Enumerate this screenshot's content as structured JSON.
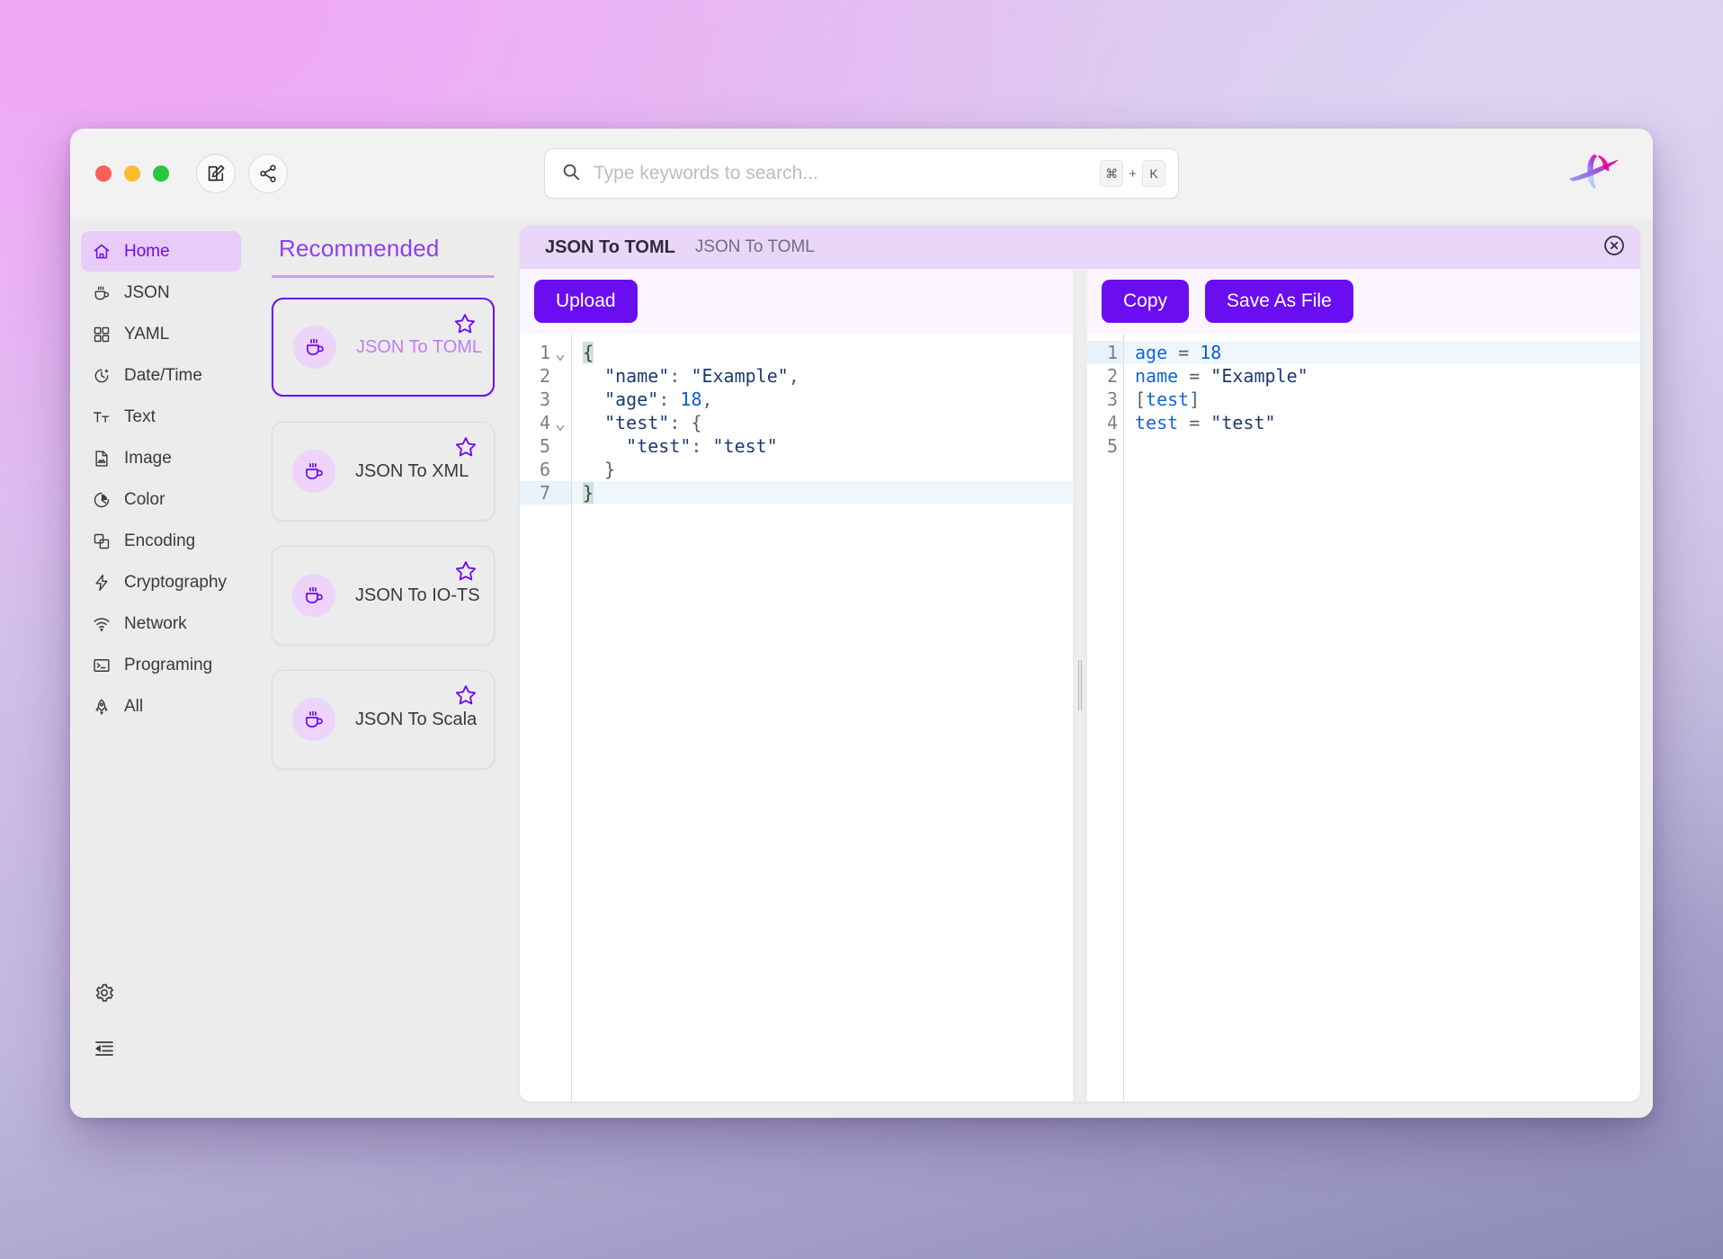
{
  "window": {
    "traffic_lights": [
      "close",
      "minimize",
      "maximize"
    ],
    "actions": [
      {
        "name": "compose",
        "label": "New"
      },
      {
        "name": "share",
        "label": "Share"
      }
    ]
  },
  "search": {
    "placeholder": "Type keywords to search...",
    "value": "",
    "shortcut_modifier": "⌘",
    "shortcut_plus": "+",
    "shortcut_key": "K"
  },
  "sidebar": {
    "items": [
      {
        "label": "Home",
        "icon": "home-icon",
        "active": true
      },
      {
        "label": "JSON",
        "icon": "cup-icon",
        "active": false
      },
      {
        "label": "YAML",
        "icon": "grid-icon",
        "active": false
      },
      {
        "label": "Date/Time",
        "icon": "clock-icon",
        "active": false
      },
      {
        "label": "Text",
        "icon": "text-icon",
        "active": false
      },
      {
        "label": "Image",
        "icon": "image-icon",
        "active": false
      },
      {
        "label": "Color",
        "icon": "pie-icon",
        "active": false
      },
      {
        "label": "Encoding",
        "icon": "layers-icon",
        "active": false
      },
      {
        "label": "Cryptography",
        "icon": "lightning-icon",
        "active": false
      },
      {
        "label": "Network",
        "icon": "wifi-icon",
        "active": false
      },
      {
        "label": "Programing",
        "icon": "terminal-icon",
        "active": false
      },
      {
        "label": "All",
        "icon": "rocket-icon",
        "active": false
      }
    ],
    "bottom": [
      {
        "name": "settings",
        "icon": "gear-icon"
      },
      {
        "name": "collapse-sidebar",
        "icon": "collapse-icon"
      }
    ]
  },
  "recommended": {
    "title": "Recommended",
    "cards": [
      {
        "label": "JSON To TOML",
        "icon": "cup-icon",
        "starred": false,
        "selected": true
      },
      {
        "label": "JSON To XML",
        "icon": "cup-icon",
        "starred": false,
        "selected": false
      },
      {
        "label": "JSON To IO-TS",
        "icon": "cup-icon",
        "starred": false,
        "selected": false
      },
      {
        "label": "JSON To Scala",
        "icon": "cup-icon",
        "starred": false,
        "selected": false
      }
    ]
  },
  "tool": {
    "tab_title": "JSON To TOML",
    "tab_subtitle": "JSON To TOML",
    "close_label": "Close"
  },
  "input_editor": {
    "upload_label": "Upload",
    "active_line": 7,
    "lines": [
      {
        "n": 1,
        "fold": true,
        "tokens": [
          {
            "t": "{",
            "c": "match"
          }
        ]
      },
      {
        "n": 2,
        "fold": false,
        "tokens": [
          {
            "t": "  ",
            "c": "punct"
          },
          {
            "t": "\"name\"",
            "c": "str"
          },
          {
            "t": ": ",
            "c": "punct"
          },
          {
            "t": "\"Example\"",
            "c": "str"
          },
          {
            "t": ",",
            "c": "punct"
          }
        ]
      },
      {
        "n": 3,
        "fold": false,
        "tokens": [
          {
            "t": "  ",
            "c": "punct"
          },
          {
            "t": "\"age\"",
            "c": "str"
          },
          {
            "t": ": ",
            "c": "punct"
          },
          {
            "t": "18",
            "c": "num"
          },
          {
            "t": ",",
            "c": "punct"
          }
        ]
      },
      {
        "n": 4,
        "fold": true,
        "tokens": [
          {
            "t": "  ",
            "c": "punct"
          },
          {
            "t": "\"test\"",
            "c": "str"
          },
          {
            "t": ": ",
            "c": "punct"
          },
          {
            "t": "{",
            "c": "punct"
          }
        ]
      },
      {
        "n": 5,
        "fold": false,
        "tokens": [
          {
            "t": "    ",
            "c": "punct"
          },
          {
            "t": "\"test\"",
            "c": "str"
          },
          {
            "t": ": ",
            "c": "punct"
          },
          {
            "t": "\"test\"",
            "c": "str"
          }
        ]
      },
      {
        "n": 6,
        "fold": false,
        "tokens": [
          {
            "t": "  ",
            "c": "punct"
          },
          {
            "t": "}",
            "c": "punct"
          }
        ]
      },
      {
        "n": 7,
        "fold": false,
        "tokens": [
          {
            "t": "}",
            "c": "match"
          }
        ]
      }
    ],
    "raw_text": "{\n  \"name\": \"Example\",\n  \"age\": 18,\n  \"test\": {\n    \"test\": \"test\"\n  }\n}"
  },
  "output_editor": {
    "copy_label": "Copy",
    "save_label": "Save As File",
    "active_line": 1,
    "lines": [
      {
        "n": 1,
        "tokens": [
          {
            "t": "age",
            "c": "key"
          },
          {
            "t": " = ",
            "c": "punct"
          },
          {
            "t": "18",
            "c": "num"
          }
        ]
      },
      {
        "n": 2,
        "tokens": [
          {
            "t": "name",
            "c": "key"
          },
          {
            "t": " = ",
            "c": "punct"
          },
          {
            "t": "\"Example\"",
            "c": "str"
          }
        ]
      },
      {
        "n": 3,
        "tokens": [
          {
            "t": "[",
            "c": "punct"
          },
          {
            "t": "test",
            "c": "key"
          },
          {
            "t": "]",
            "c": "punct"
          }
        ]
      },
      {
        "n": 4,
        "tokens": [
          {
            "t": "test",
            "c": "key"
          },
          {
            "t": " = ",
            "c": "punct"
          },
          {
            "t": "\"test\"",
            "c": "str"
          }
        ]
      },
      {
        "n": 5,
        "tokens": []
      }
    ],
    "raw_text": "age = 18\nname = \"Example\"\n[test]\ntest = \"test\"\n"
  },
  "colors": {
    "accent": "#6a0df0",
    "accent_light": "#8e3ff0",
    "tab_bar": "#e9d6f8",
    "sidebar_active": "#e7ccfa",
    "card_icon_bg": "#eed4fb",
    "panel_bg": "#faf5ff",
    "traffic_red": "#ff5f57",
    "traffic_yellow": "#febc2e",
    "traffic_green": "#28c840"
  }
}
